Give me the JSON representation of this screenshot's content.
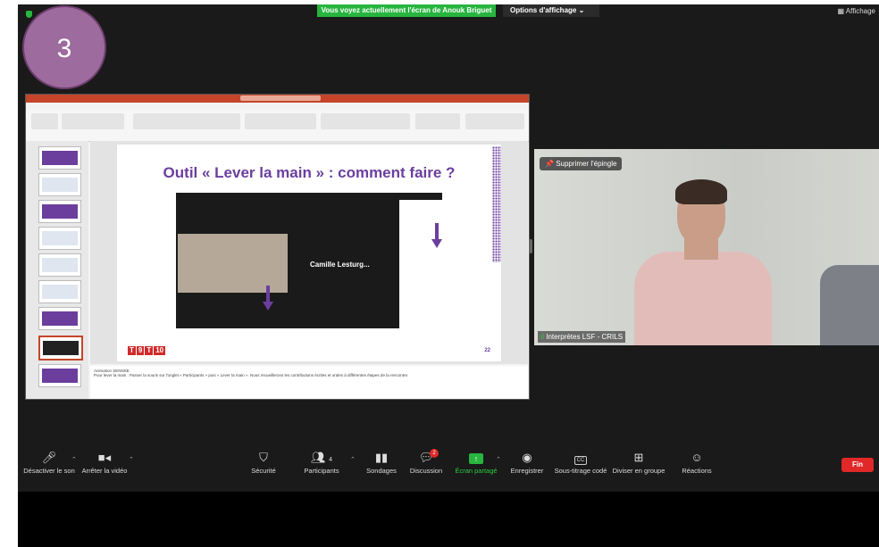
{
  "top": {
    "banner": "Vous voyez actuellement l'écran de Anouk Briguet",
    "view_options": "Options d'affichage ⌄",
    "display_button": "Affichage"
  },
  "badge": {
    "number": "3"
  },
  "slide": {
    "title": "Outil « Lever la main » : comment faire ?",
    "inner_participant": "Camille  Lesturg...",
    "logo": [
      "T",
      "9",
      "T",
      "10"
    ],
    "page_number": "22"
  },
  "notes": {
    "line1": "Animation SENNSE",
    "line2": "Pour lever la main : Passer la souris sur l'onglet « Participants » puis « Lever la main ». Nous recueillerons les contributions écrites et orales à différentes étapes de la rencontre."
  },
  "video": {
    "pin_label": "Supprimer l'épingle",
    "participant_name": "Interprètes LSF - CRILS"
  },
  "controls": {
    "mute": "Désactiver le son",
    "stop_video": "Arrêter la vidéo",
    "security": "Sécurité",
    "participants": "Participants",
    "participants_count": "4",
    "polls": "Sondages",
    "chat": "Discussion",
    "chat_count": "2",
    "share": "Écran partagé",
    "record": "Enregistrer",
    "captions": "Sous-titrage codé",
    "breakout": "Diviser en groupe",
    "reactions": "Réactions",
    "end": "Fin"
  },
  "colors": {
    "share_green": "#27b53f",
    "end_red": "#e02828",
    "slide_purple": "#6b3e9e",
    "badge_purple": "#9d6b9d"
  }
}
